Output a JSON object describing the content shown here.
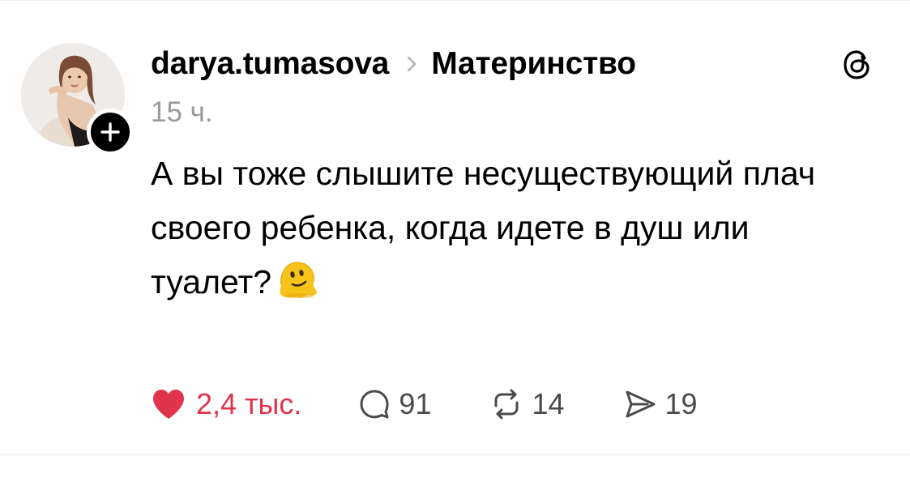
{
  "post": {
    "username": "darya.tumasova",
    "topic": "Материнство",
    "timestamp": "15 ч.",
    "text": "А вы тоже слышите несуществующий плач своего ребенка, когда идете в душ или туалет?",
    "emoji": "melting-face-emoji"
  },
  "actions": {
    "likes": "2,4 тыс.",
    "replies": "91",
    "reposts": "14",
    "shares": "19"
  },
  "colors": {
    "like_red": "#e0344c",
    "muted_gray": "#9a9a9a",
    "text": "#000000"
  },
  "icons": [
    "avatar-photo",
    "plus-icon",
    "chevron-right-icon",
    "threads-logo-icon",
    "heart-icon",
    "comment-icon",
    "repost-icon",
    "share-icon",
    "melting-face-emoji"
  ]
}
